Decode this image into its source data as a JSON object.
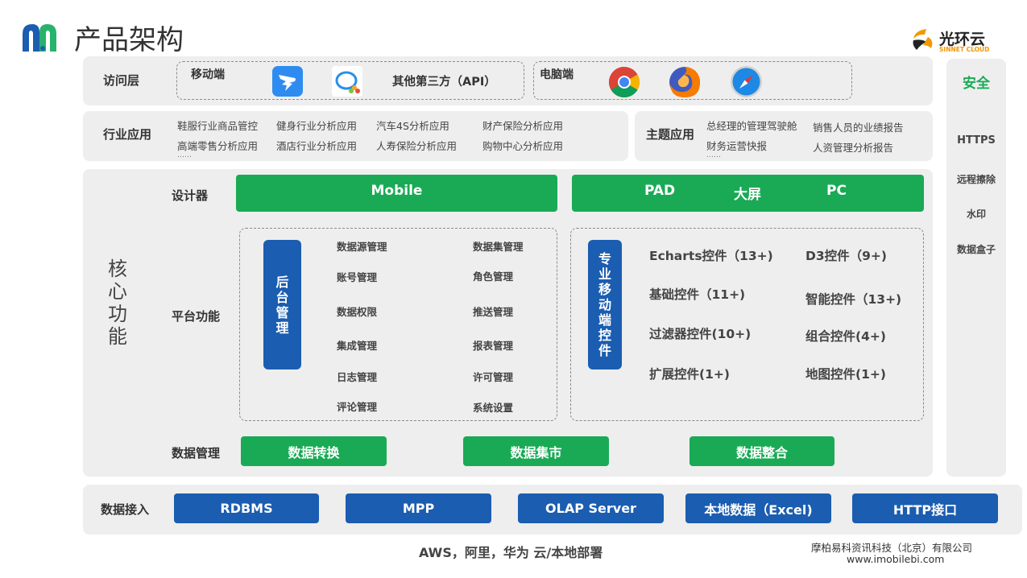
{
  "header": {
    "title": "产品架构",
    "brand_name": "光环云",
    "brand_sub": "SINNET CLOUD"
  },
  "access": {
    "label": "访问层",
    "mobile_label": "移动端",
    "third_party_label": "其他第三方（API）",
    "pc_label": "电脑端"
  },
  "industry": {
    "label": "行业应用",
    "items": [
      "鞋服行业商品管控",
      "健身行业分析应用",
      "汽车4S分析应用",
      "财产保险分析应用",
      "高端零售分析应用",
      "酒店行业分析应用",
      "人寿保险分析应用",
      "购物中心分析应用"
    ],
    "ellipsis": "……"
  },
  "theme": {
    "label": "主题应用",
    "items": [
      "总经理的管理驾驶舱",
      "销售人员的业绩报告",
      "财务运营快报",
      "人资管理分析报告"
    ],
    "ellipsis": "……"
  },
  "core": {
    "label": "核心功能",
    "designer_label": "设计器",
    "mobile_btn": "Mobile",
    "pad": "PAD",
    "bigscreen": "大屏",
    "pc": "PC",
    "platform_label": "平台功能",
    "backend_label": "后台管理",
    "backend_items": [
      "数据源管理",
      "数据集管理",
      "账号管理",
      "角色管理",
      "数据权限",
      "推送管理",
      "集成管理",
      "报表管理",
      "日志管理",
      "许可管理",
      "评论管理",
      "系统设置"
    ],
    "mobile_ctrl_label": "专业移动端控件",
    "widgets": [
      "Echarts控件（13+)",
      "D3控件（9+)",
      "基础控件（11+)",
      "智能控件（13+)",
      "过滤器控件(10+)",
      "组合控件(4+)",
      "扩展控件(1+)",
      "地图控件(1+)"
    ],
    "data_mgmt_label": "数据管理",
    "data_mgmt_items": [
      "数据转换",
      "数据集市",
      "数据整合"
    ]
  },
  "security": {
    "label": "安全",
    "items": [
      "HTTPS",
      "远程擦除",
      "水印",
      "数据盒子"
    ]
  },
  "data_access": {
    "label": "数据接入",
    "items": [
      "RDBMS",
      "MPP",
      "OLAP Server",
      "本地数据（Excel)",
      "HTTP接口"
    ]
  },
  "footer": {
    "deploy": "AWS，阿里，华为 云/本地部署",
    "company": "摩柏易科资讯科技（北京）有限公司",
    "website": "www.imobilebi.com"
  },
  "colors": {
    "green": "#1aaa55",
    "blue": "#1b5db0",
    "band": "#eeeeee",
    "logo_blue": "#1b5db0",
    "logo_green": "#27b36b"
  }
}
